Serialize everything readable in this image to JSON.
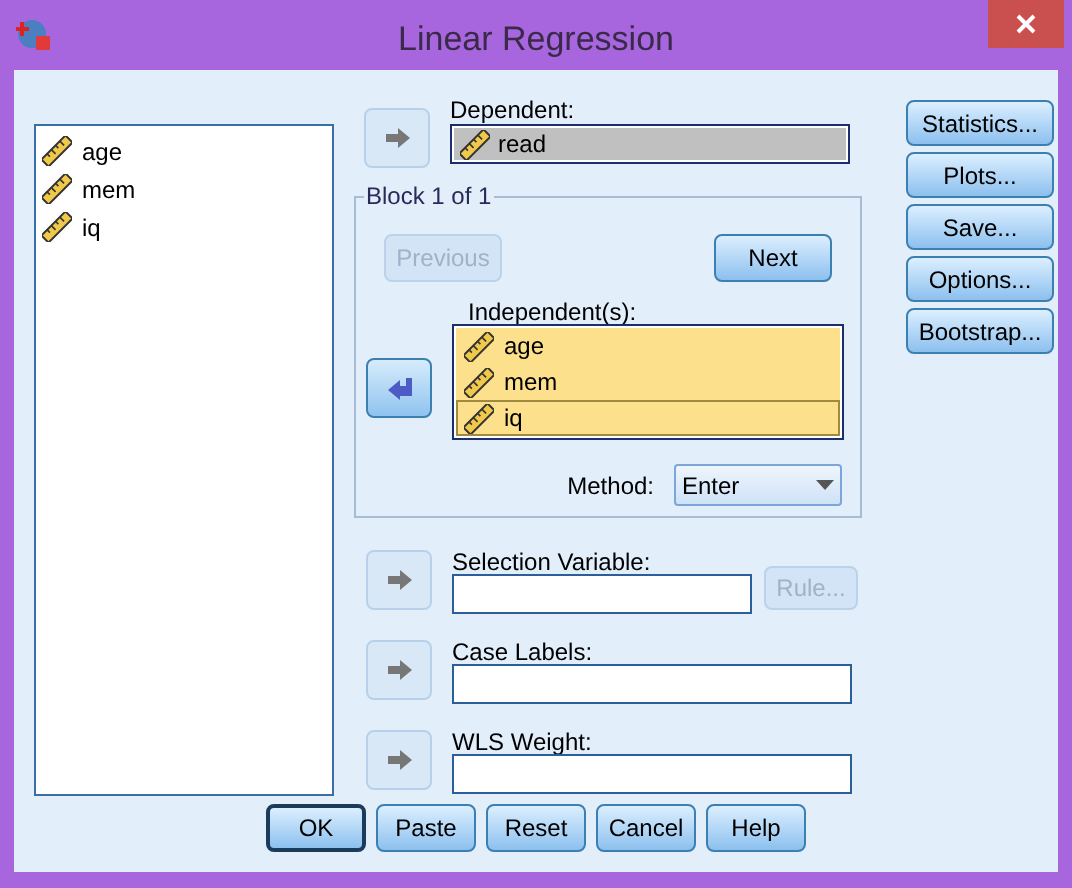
{
  "window": {
    "title": "Linear Regression"
  },
  "variables": [
    {
      "name": "age"
    },
    {
      "name": "mem"
    },
    {
      "name": "iq"
    }
  ],
  "dependent": {
    "label": "Dependent:",
    "value": "read",
    "arrow": {
      "kind": "right",
      "active": false
    }
  },
  "block": {
    "title": "Block 1 of 1",
    "previous": {
      "label": "Previous",
      "disabled": true
    },
    "next": {
      "label": "Next",
      "disabled": false
    },
    "independents_label": "Independent(s):",
    "arrow": {
      "kind": "left",
      "active": true
    },
    "independents": [
      {
        "name": "age",
        "selected": true,
        "focused": false
      },
      {
        "name": "mem",
        "selected": true,
        "focused": false
      },
      {
        "name": "iq",
        "selected": true,
        "focused": true
      }
    ],
    "method_label": "Method:",
    "method": "Enter"
  },
  "side_buttons": [
    "Statistics...",
    "Plots...",
    "Save...",
    "Options...",
    "Bootstrap..."
  ],
  "fields": [
    {
      "label": "Selection Variable:",
      "arrow": {
        "kind": "right",
        "active": false
      },
      "rule_button": {
        "label": "Rule...",
        "disabled": true
      }
    },
    {
      "label": "Case Labels:",
      "arrow": {
        "kind": "right",
        "active": false
      }
    },
    {
      "label": "WLS Weight:",
      "arrow": {
        "kind": "right",
        "active": false
      }
    }
  ],
  "buttons": [
    {
      "label": "OK",
      "default": true
    },
    {
      "label": "Paste",
      "default": false
    },
    {
      "label": "Reset",
      "default": false
    },
    {
      "label": "Cancel",
      "default": false
    },
    {
      "label": "Help",
      "default": false
    }
  ]
}
